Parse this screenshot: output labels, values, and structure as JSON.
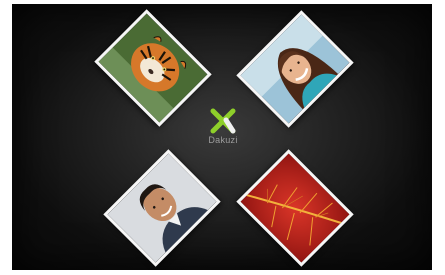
{
  "logo": {
    "name": "Dakuzi",
    "tagline": "",
    "accent_color": "#8ecf2a"
  },
  "tiles": [
    {
      "subject": "tiger",
      "icon": "tiger-photo"
    },
    {
      "subject": "woman",
      "icon": "woman-portrait-photo"
    },
    {
      "subject": "man",
      "icon": "man-portrait-photo"
    },
    {
      "subject": "red-leaf",
      "icon": "red-leaf-photo"
    }
  ],
  "colors": {
    "background": "#141414",
    "tile_border": "#f6f6f6",
    "leaf_red": "#c8231e"
  }
}
